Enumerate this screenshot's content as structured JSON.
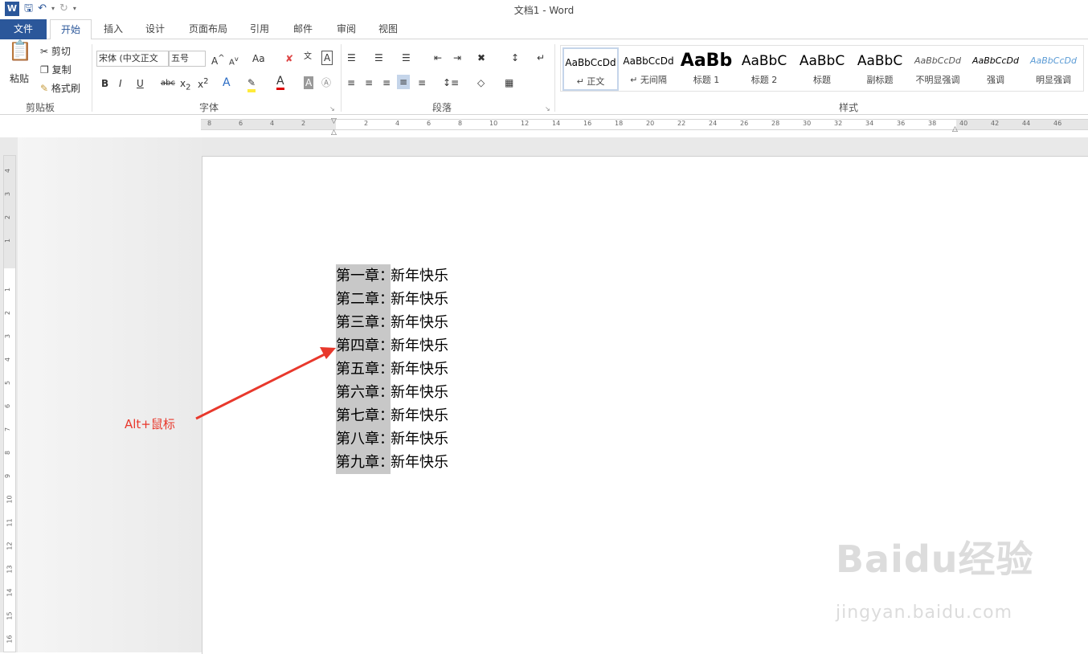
{
  "window": {
    "title": "文档1 - Word"
  },
  "tabs": [
    {
      "label": "文件"
    },
    {
      "label": "开始"
    },
    {
      "label": "插入"
    },
    {
      "label": "设计"
    },
    {
      "label": "页面布局"
    },
    {
      "label": "引用"
    },
    {
      "label": "邮件"
    },
    {
      "label": "审阅"
    },
    {
      "label": "视图"
    }
  ],
  "clipboard": {
    "paste": "粘贴",
    "cut": "剪切",
    "copy": "复制",
    "format_painter": "格式刷",
    "group": "剪贴板"
  },
  "font": {
    "name": "宋体 (中文正文",
    "size": "五号",
    "group": "字体",
    "case": "Aa"
  },
  "paragraph": {
    "group": "段落"
  },
  "styles": {
    "group": "样式",
    "items": [
      {
        "sample": "AaBbCcDd",
        "name": "↵ 正文"
      },
      {
        "sample": "AaBbCcDd",
        "name": "↵ 无间隔"
      },
      {
        "sample": "AaBb",
        "name": "标题 1"
      },
      {
        "sample": "AaBbC",
        "name": "标题 2"
      },
      {
        "sample": "AaBbC",
        "name": "标题"
      },
      {
        "sample": "AaBbC",
        "name": "副标题"
      },
      {
        "sample": "AaBbCcDd",
        "name": "不明显强调"
      },
      {
        "sample": "AaBbCcDd",
        "name": "强调"
      },
      {
        "sample": "AaBbCcDd",
        "name": "明显强调"
      }
    ]
  },
  "ruler": {
    "h_labels": [
      "8",
      "6",
      "4",
      "2",
      "2",
      "4",
      "6",
      "8",
      "10",
      "12",
      "14",
      "16",
      "18",
      "20",
      "22",
      "24",
      "26",
      "28",
      "30",
      "32",
      "34",
      "36",
      "38",
      "40",
      "42",
      "44",
      "46"
    ],
    "v_labels": [
      "4",
      "3",
      "2",
      "1",
      "1",
      "2",
      "3",
      "4",
      "5",
      "6",
      "7",
      "8",
      "9",
      "10",
      "11",
      "12",
      "13",
      "14",
      "15",
      "16"
    ]
  },
  "document": {
    "lines": [
      {
        "sel": "第一章：",
        "rest": "新年快乐"
      },
      {
        "sel": "第二章：",
        "rest": "新年快乐"
      },
      {
        "sel": "第三章：",
        "rest": "新年快乐"
      },
      {
        "sel": "第四章：",
        "rest": "新年快乐"
      },
      {
        "sel": "第五章：",
        "rest": "新年快乐"
      },
      {
        "sel": "第六章：",
        "rest": "新年快乐"
      },
      {
        "sel": "第七章：",
        "rest": "新年快乐"
      },
      {
        "sel": "第八章：",
        "rest": "新年快乐"
      },
      {
        "sel": "第九章：",
        "rest": "新年快乐"
      }
    ]
  },
  "annotation": {
    "text": "Alt+鼠标",
    "color": "#e8382c"
  },
  "watermark": {
    "main": "Baidu经验",
    "sub": "jingyan.baidu.com"
  }
}
